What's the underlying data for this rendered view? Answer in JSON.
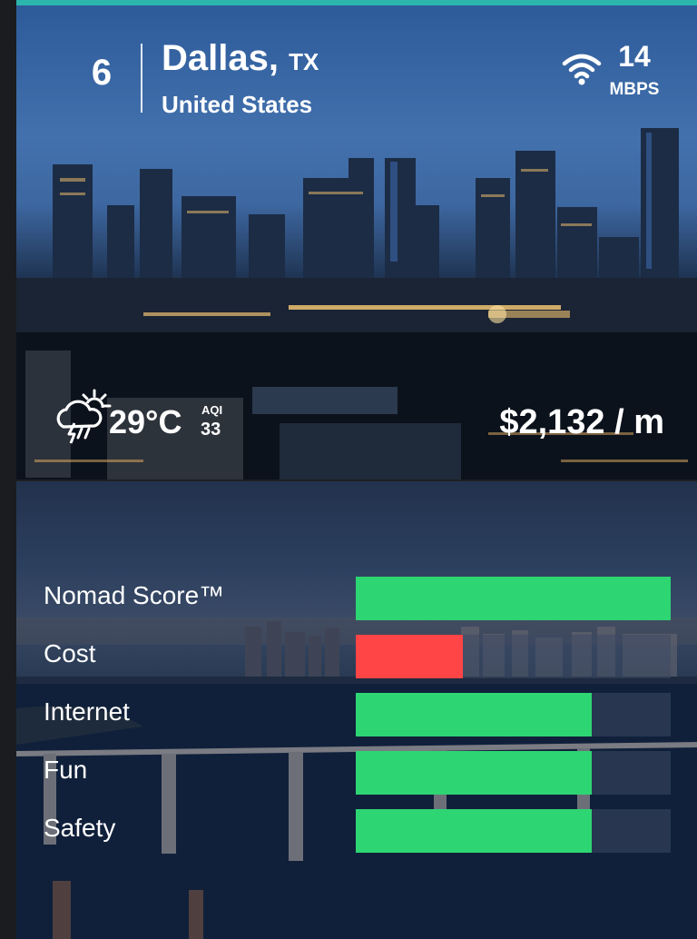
{
  "city": {
    "rank": "6",
    "name": "Dallas,",
    "state": "TX",
    "country": "United States"
  },
  "internet": {
    "speed": "14",
    "unit": "MBPS"
  },
  "weather": {
    "icon": "thunderstorm-sun-icon",
    "temperature": "29°C",
    "aqi_label": "AQI",
    "aqi_value": "33"
  },
  "cost_of_living": "$2,132 / m",
  "colors": {
    "accent": "#2bb5ac",
    "good": "#2ed573",
    "bad": "#ff4545"
  },
  "scores": [
    {
      "label": "Nomad Score™",
      "value": 1.0,
      "color": "#2ed573"
    },
    {
      "label": "Cost",
      "value": 0.34,
      "color": "#ff4545"
    },
    {
      "label": "Internet",
      "value": 0.75,
      "color": "#2ed573"
    },
    {
      "label": "Fun",
      "value": 0.75,
      "color": "#2ed573"
    },
    {
      "label": "Safety",
      "value": 0.75,
      "color": "#2ed573"
    }
  ]
}
